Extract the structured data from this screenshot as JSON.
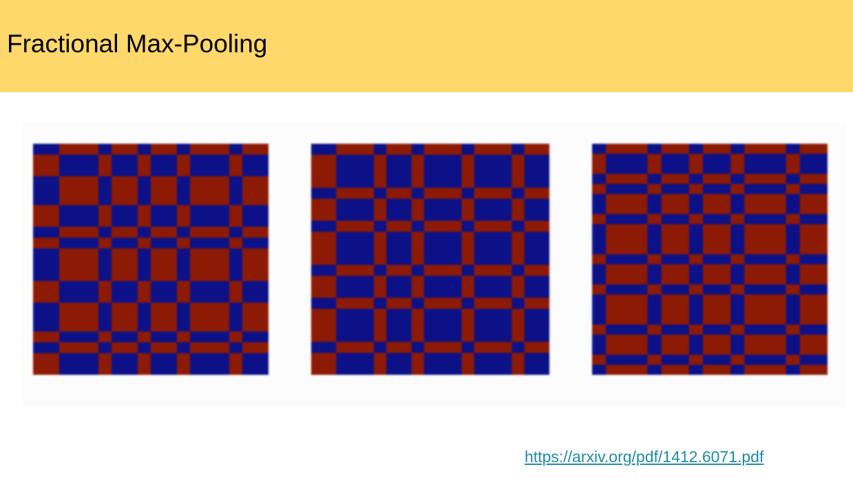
{
  "slide": {
    "title": "Fractional Max-Pooling",
    "link_text": "https://arxiv.org/pdf/1412.6071.pdf"
  },
  "colors": {
    "header_bg": "#fed86a",
    "cell_blue": "#0c1187",
    "cell_red": "#8c1a04"
  },
  "grids": [
    {
      "name": "pooling-grid-1",
      "cols": [
        30,
        45,
        15,
        30,
        15,
        30,
        15,
        45,
        15,
        30
      ],
      "rows": [
        15,
        30,
        40,
        30,
        15,
        15,
        45,
        30,
        40,
        15,
        15,
        30
      ]
    },
    {
      "name": "pooling-grid-2",
      "cols": [
        30,
        45,
        15,
        30,
        15,
        45,
        15,
        45,
        15,
        30
      ],
      "rows": [
        15,
        45,
        15,
        30,
        15,
        45,
        15,
        30,
        15,
        45,
        15,
        30
      ]
    },
    {
      "name": "pooling-grid-3",
      "cols": [
        15,
        45,
        15,
        30,
        15,
        30,
        15,
        45,
        15,
        30
      ],
      "rows": [
        15,
        30,
        15,
        15,
        30,
        15,
        45,
        15,
        30,
        15,
        45,
        15,
        30,
        15,
        15
      ]
    }
  ]
}
